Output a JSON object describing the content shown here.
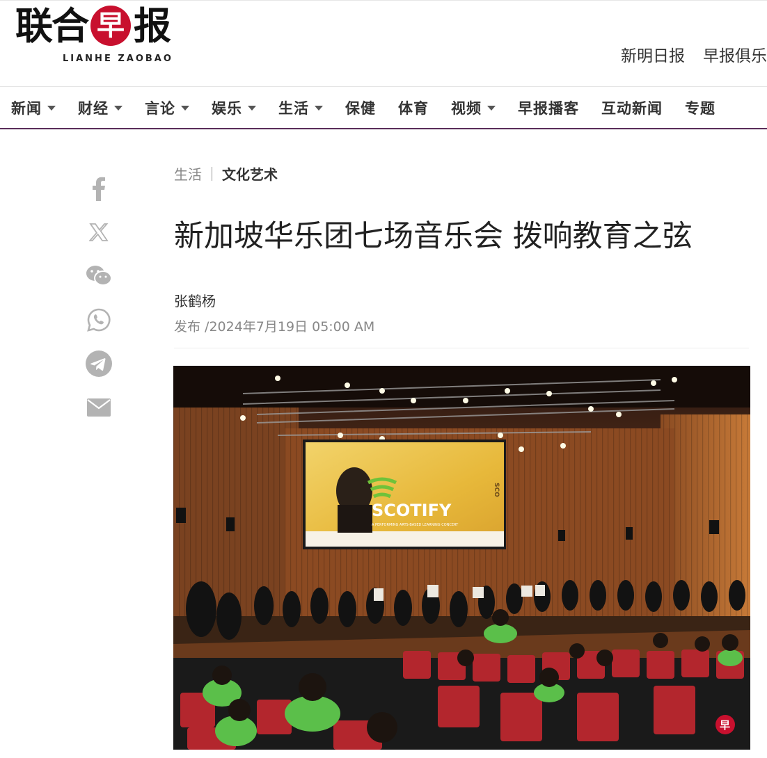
{
  "brand": {
    "name_chars": [
      "联",
      "合",
      "早",
      "报"
    ],
    "subtitle": "LIANHE ZAOBAO",
    "accent_color": "#c8102e"
  },
  "top_links": [
    "新明日报",
    "早报俱乐"
  ],
  "nav": {
    "items": [
      {
        "label": "新闻",
        "dropdown": true
      },
      {
        "label": "财经",
        "dropdown": true
      },
      {
        "label": "言论",
        "dropdown": true
      },
      {
        "label": "娱乐",
        "dropdown": true
      },
      {
        "label": "生活",
        "dropdown": true
      },
      {
        "label": "保健",
        "dropdown": false
      },
      {
        "label": "体育",
        "dropdown": false
      },
      {
        "label": "视频",
        "dropdown": true
      },
      {
        "label": "早报播客",
        "dropdown": false
      },
      {
        "label": "互动新闻",
        "dropdown": false
      },
      {
        "label": "专题",
        "dropdown": false
      }
    ],
    "underline_color": "#5a2d5a"
  },
  "share": {
    "icons": [
      "facebook-icon",
      "x-icon",
      "wechat-icon",
      "whatsapp-icon",
      "telegram-icon",
      "email-icon"
    ]
  },
  "article": {
    "breadcrumb": {
      "section": "生活",
      "subsection": "文化艺术"
    },
    "headline": "新加坡华乐团七场音乐会 拨响教育之弦",
    "author": "张鹤杨",
    "published": "发布 /2024年7月19日 05:00 AM",
    "photo": {
      "screen_text": "SCOTIFY",
      "screen_subtitle": "A PERFORMING ARTS-BASED LEARNING CONCERT",
      "screen_side_text": "SCO",
      "watermark": "早"
    }
  }
}
